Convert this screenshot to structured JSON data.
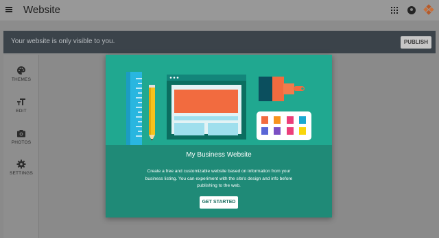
{
  "appbar": {
    "title": "Website",
    "icons": [
      "menu-icon",
      "apps-grid-icon",
      "account-icon",
      "brand-logo"
    ]
  },
  "notice": {
    "text": "Your website is only visible to you.",
    "publish_label": "PUBLISH"
  },
  "sidebar": {
    "items": [
      {
        "label": "THEMES",
        "icon": "palette-icon"
      },
      {
        "label": "EDIT",
        "icon": "text-edit-icon"
      },
      {
        "label": "PHOTOS",
        "icon": "camera-icon"
      },
      {
        "label": "SETTINGS",
        "icon": "gear-icon"
      }
    ]
  },
  "dialog": {
    "title": "My Business Website",
    "body": "Create a free and customizable website based on information from your business listing. You can experiment with the site's design and info before publishing to the web.",
    "button_label": "GET STARTED"
  },
  "colors": {
    "illustration_bg": "#20a890",
    "dialog_bg": "#1f8a77",
    "notice_bg": "#3b434a",
    "accent_orange": "#f26b3f"
  }
}
